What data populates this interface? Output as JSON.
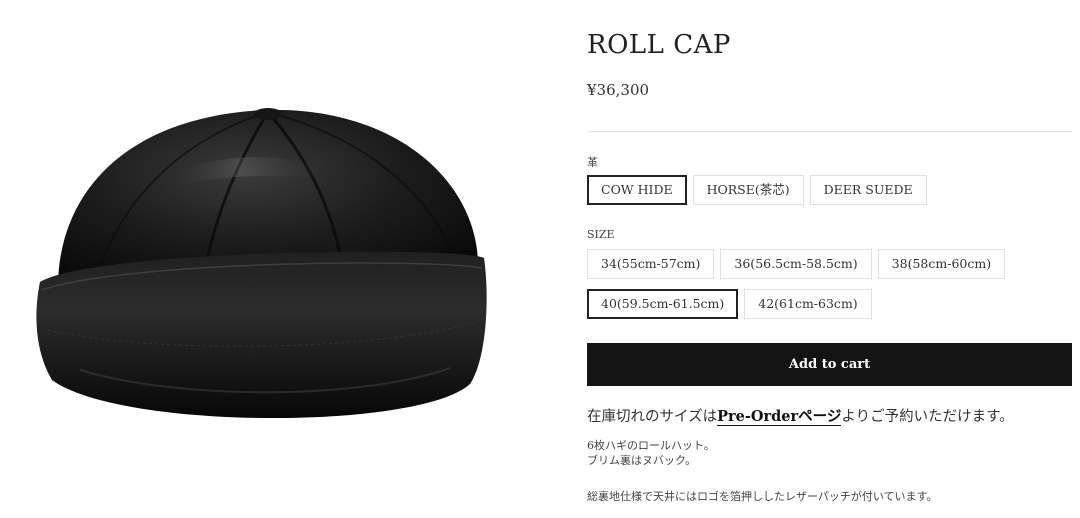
{
  "product": {
    "title": "ROLL CAP",
    "price": "¥36,300"
  },
  "material": {
    "label": "革",
    "options": [
      "COW HIDE",
      "HORSE(茶芯)",
      "DEER SUEDE"
    ],
    "selected": "COW HIDE"
  },
  "size": {
    "label": "SIZE",
    "options": [
      "34(55cm-57cm)",
      "36(56.5cm-58.5cm)",
      "38(58cm-60cm)",
      "40(59.5cm-61.5cm)",
      "42(61cm-63cm)"
    ],
    "selected": "40(59.5cm-61.5cm)"
  },
  "cart": {
    "label": "Add to cart"
  },
  "notice": {
    "before": "在庫切れのサイズは",
    "link": "Pre-Orderページ",
    "after": "よりご予約いただけます。"
  },
  "description": {
    "line1": "6枚ハギのロールハット。",
    "line2": "ブリム裏はヌバック。",
    "line3": "総裏地仕様で天井にはロゴを箔押ししたレザーパッチが付いています。"
  },
  "colors": {
    "accent": "#141414",
    "border": "#e0e0e0",
    "selected_border": "#222222"
  },
  "icons": {
    "product_image": "leather-roll-cap-image"
  }
}
